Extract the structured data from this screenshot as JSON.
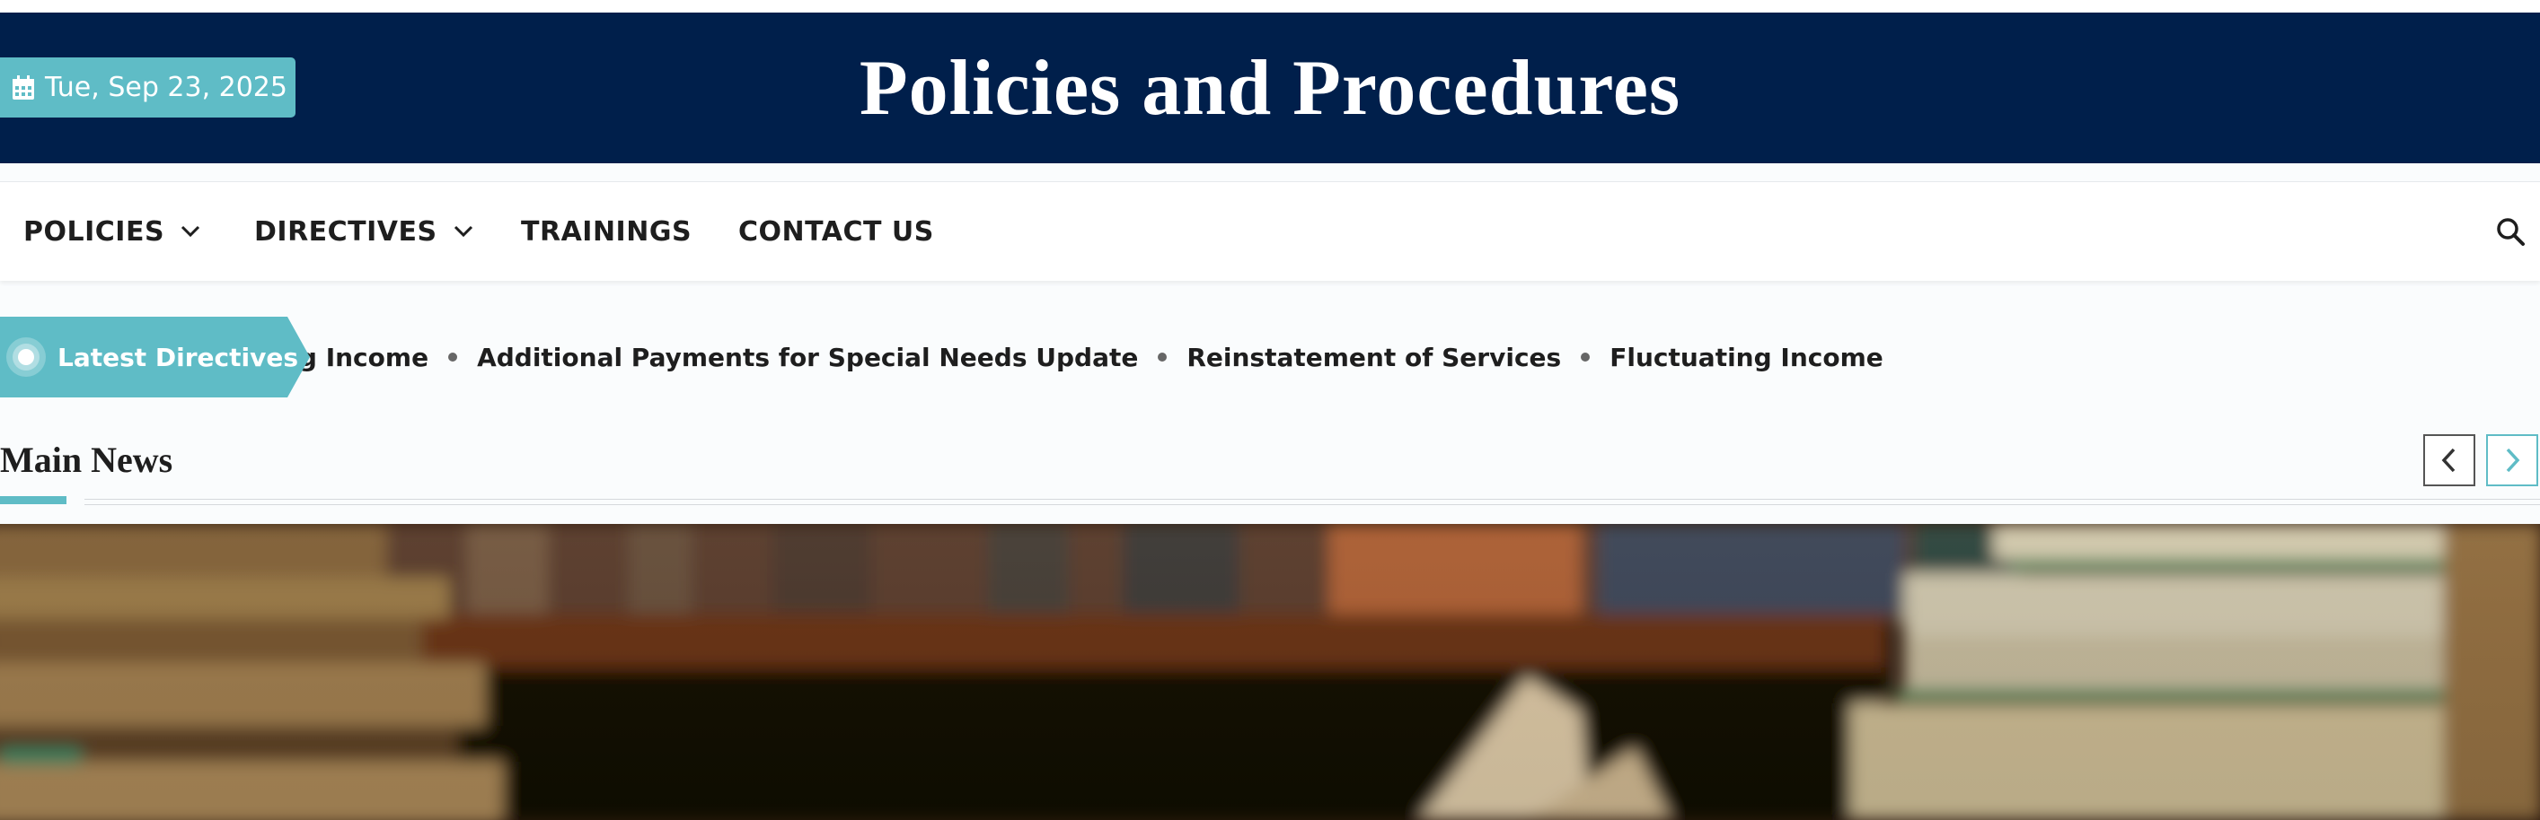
{
  "header": {
    "date": "Tue, Sep 23, 2025",
    "site_title": "Policies and Procedures",
    "background": "#001f4b",
    "accent": "#5fbcc6"
  },
  "nav": {
    "items": [
      {
        "label": "POLICIES",
        "has_dropdown": true
      },
      {
        "label": "DIRECTIVES",
        "has_dropdown": true
      },
      {
        "label": "TRAININGS",
        "has_dropdown": false
      },
      {
        "label": "CONTACT US",
        "has_dropdown": false
      }
    ],
    "search_icon": "search-icon"
  },
  "ticker": {
    "label": "Latest Directives",
    "items": [
      "ting Income",
      "Additional Payments for Special Needs Update",
      "Reinstatement of Services",
      "Fluctuating Income"
    ]
  },
  "main_news": {
    "title": "Main News",
    "prev_icon": "chevron-left-icon",
    "next_icon": "chevron-right-icon"
  },
  "hero": {
    "image": "blurred-books-photo"
  }
}
